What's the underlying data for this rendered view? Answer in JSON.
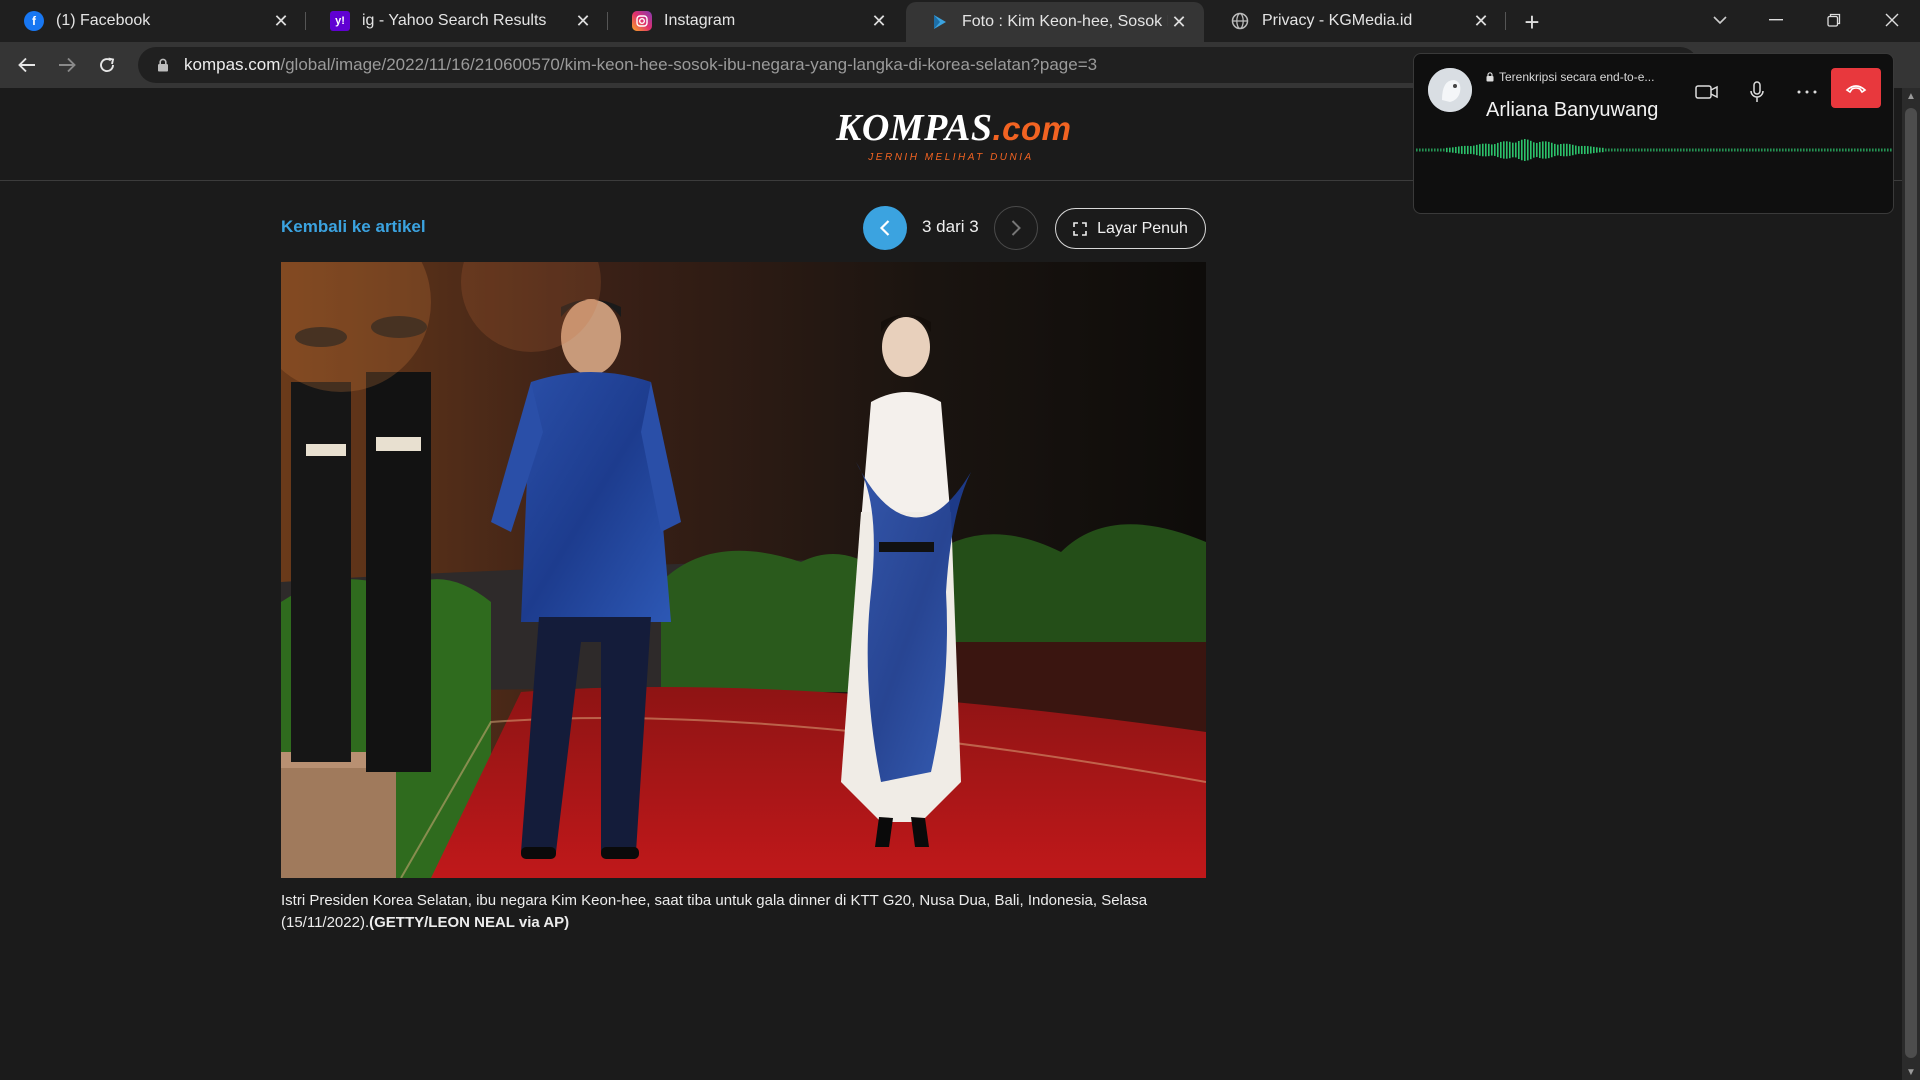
{
  "browser": {
    "tabs": [
      {
        "title": "(1) Facebook",
        "icon": "facebook-icon",
        "color": "#1877f2",
        "glyph": "f"
      },
      {
        "title": "ig - Yahoo Search Results",
        "icon": "yahoo-icon",
        "color": "#6001d2",
        "glyph": "y!"
      },
      {
        "title": "Instagram",
        "icon": "instagram-icon",
        "color": "#e1306c",
        "glyph": "◎"
      },
      {
        "title": "Foto : Kim Keon-hee, Sosok Ibu N",
        "icon": "kompas-icon",
        "color": "#3ba3e0",
        "glyph": "K"
      },
      {
        "title": "Privacy - KGMedia.id",
        "icon": "globe-icon",
        "color": "#8a8a8a",
        "glyph": ""
      }
    ],
    "new_tab_glyph": "+",
    "url_host": "kompas.com",
    "url_path": "/global/image/2022/11/16/210600570/kim-keon-hee-sosok-ibu-negara-yang-langka-di-korea-selatan?page=3"
  },
  "site": {
    "logo_main": "KOMPAS",
    "logo_suffix": ".com",
    "logo_tagline": "JERNIH MELIHAT DUNIA",
    "brand_color": "#f26322",
    "link_color": "#3ba3e0"
  },
  "gallery": {
    "back_label": "Kembali ke artikel",
    "counter": "3 dari 3",
    "fullscreen_label": "Layar Penuh",
    "caption_text": "Istri Presiden Korea Selatan, ibu negara Kim Keon-hee, saat tiba untuk gala dinner di KTT G20, Nusa Dua, Bali, Indonesia, Selasa (15/11/2022).",
    "caption_credit": "(GETTY/LEON NEAL via AP)"
  },
  "call": {
    "encryption_label": "Terenkripsi secara end-to-e...",
    "contact_name": "Arliana Banyuwang",
    "end_color": "#e8383d",
    "wave_color": "#2ecc71"
  }
}
